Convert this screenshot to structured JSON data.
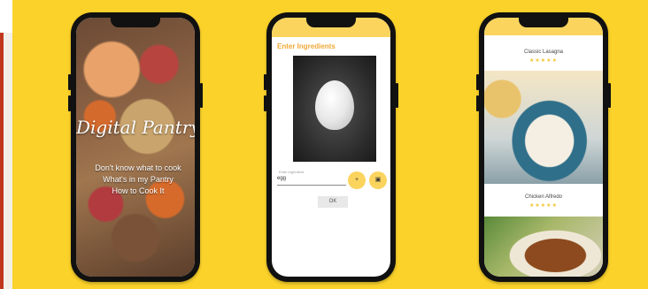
{
  "splash": {
    "title": "Digital Pantry",
    "lines": [
      "Don't know what to cook",
      "What's in my Pantry",
      "How to Cook It"
    ]
  },
  "ingredients": {
    "appbar_title": "",
    "title": "Enter Ingredients",
    "field_label": "Enter ingredient",
    "field_value": "egg",
    "add_label": "+",
    "camera_label": "▣",
    "ok_label": "OK"
  },
  "recipes": {
    "items": [
      {
        "name": "Classic Lasagna",
        "stars": "★★★★★"
      },
      {
        "name": "Chicken Alfredo",
        "stars": "★★★★★"
      }
    ]
  }
}
